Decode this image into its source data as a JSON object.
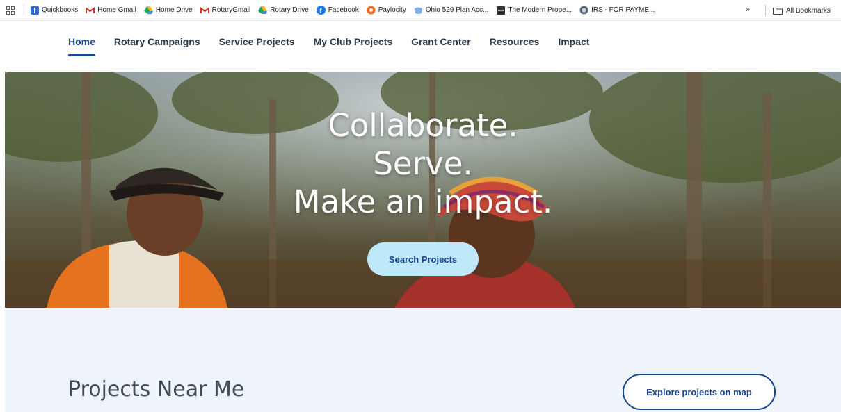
{
  "bookmarks_bar": {
    "items": [
      {
        "label": "Quickbooks",
        "icon": "quickbooks-icon",
        "color": "#2c6ed5"
      },
      {
        "label": "Home Gmail",
        "icon": "gmail-icon",
        "color": "#d93025"
      },
      {
        "label": "Home Drive",
        "icon": "google-drive-icon",
        "color": "#1fa463"
      },
      {
        "label": "RotaryGmail",
        "icon": "gmail-icon",
        "color": "#d93025"
      },
      {
        "label": "Rotary Drive",
        "icon": "google-drive-icon",
        "color": "#1fa463"
      },
      {
        "label": "Facebook",
        "icon": "facebook-icon",
        "color": "#1877f2"
      },
      {
        "label": "Paylocity",
        "icon": "paylocity-icon",
        "color": "#f26b21"
      },
      {
        "label": "Ohio 529 Plan Acc...",
        "icon": "ohio-529-icon",
        "color": "#3a78c9"
      },
      {
        "label": "The Modern Prope...",
        "icon": "modern-property-icon",
        "color": "#333333"
      },
      {
        "label": "IRS - FOR PAYME...",
        "icon": "irs-icon",
        "color": "#5a6b7d"
      }
    ],
    "overflow": "»",
    "all_bookmarks": "All Bookmarks"
  },
  "nav": {
    "items": [
      {
        "label": "Home",
        "active": true
      },
      {
        "label": "Rotary Campaigns"
      },
      {
        "label": "Service Projects"
      },
      {
        "label": "My Club Projects"
      },
      {
        "label": "Grant Center"
      },
      {
        "label": "Resources"
      },
      {
        "label": "Impact"
      }
    ],
    "active_color": "#17458f"
  },
  "hero": {
    "headline_lines": [
      "Collaborate.",
      "Serve.",
      "Make an impact."
    ],
    "cta_label": "Search Projects",
    "cta_color": "#bfe8f8"
  },
  "projects": {
    "title": "Projects Near Me",
    "map_button": "Explore projects on map",
    "background": "#eef4fa"
  }
}
